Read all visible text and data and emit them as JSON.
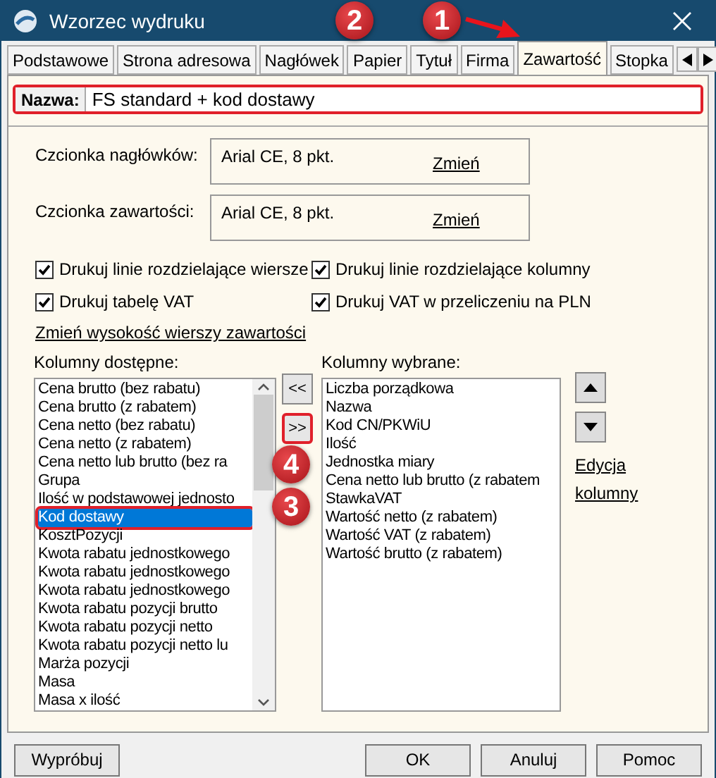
{
  "window": {
    "title": "Wzorzec wydruku"
  },
  "tabs": [
    {
      "label": "Podstawowe",
      "selected": false
    },
    {
      "label": "Strona adresowa",
      "selected": false
    },
    {
      "label": "Nagłówek",
      "selected": false
    },
    {
      "label": "Papier",
      "selected": false
    },
    {
      "label": "Tytuł",
      "selected": false
    },
    {
      "label": "Firma",
      "selected": false
    },
    {
      "label": "Zawartość",
      "selected": true
    },
    {
      "label": "Stopka",
      "selected": false
    }
  ],
  "name_field": {
    "label": "Nazwa:",
    "value": "FS standard + kod dostawy",
    "highlighted": true
  },
  "fonts": [
    {
      "label": "Czcionka nagłówków:",
      "value": "Arial CE, 8 pkt.",
      "link": "Zmień"
    },
    {
      "label": "Czcionka zawartości:",
      "value": "Arial CE, 8 pkt.",
      "link": "Zmień"
    }
  ],
  "options": [
    {
      "label": "Drukuj linie rozdzielające wiersze",
      "checked": true
    },
    {
      "label": "Drukuj linie rozdzielające kolumny",
      "checked": true
    },
    {
      "label": "Drukuj tabelę VAT",
      "checked": true
    },
    {
      "label": "Drukuj VAT w przeliczeniu na PLN",
      "checked": true
    }
  ],
  "row_height_link": "Zmień wysokość wierszy zawartości",
  "available": {
    "label": "Kolumny dostępne:",
    "items": [
      {
        "text": "Cena brutto (bez rabatu)",
        "selected": false
      },
      {
        "text": "Cena brutto (z rabatem)",
        "selected": false
      },
      {
        "text": "Cena netto (bez rabatu)",
        "selected": false
      },
      {
        "text": "Cena netto (z rabatem)",
        "selected": false
      },
      {
        "text": "Cena netto lub brutto (bez ra",
        "selected": false
      },
      {
        "text": "Grupa",
        "selected": false
      },
      {
        "text": "Ilość w podstawowej jednosto",
        "selected": false
      },
      {
        "text": "Kod dostawy",
        "selected": true
      },
      {
        "text": "KosztPozycji",
        "selected": false
      },
      {
        "text": "Kwota rabatu jednostkowego",
        "selected": false
      },
      {
        "text": "Kwota rabatu jednostkowego",
        "selected": false
      },
      {
        "text": "Kwota rabatu jednostkowego",
        "selected": false
      },
      {
        "text": "Kwota rabatu pozycji brutto",
        "selected": false
      },
      {
        "text": "Kwota rabatu pozycji netto",
        "selected": false
      },
      {
        "text": "Kwota rabatu pozycji netto lu",
        "selected": false
      },
      {
        "text": "Marża pozycji",
        "selected": false
      },
      {
        "text": "Masa",
        "selected": false
      },
      {
        "text": "Masa x ilość",
        "selected": false
      }
    ]
  },
  "move_buttons": [
    {
      "label": "<<",
      "highlighted": false
    },
    {
      "label": ">>",
      "highlighted": true
    }
  ],
  "chosen": {
    "label": "Kolumny wybrane:",
    "items": [
      "Liczba porządkowa",
      "Nazwa",
      "Kod CN/PKWiU",
      "Ilość",
      "Jednostka miary",
      "Cena netto lub brutto (z rabatem",
      "StawkaVAT",
      "Wartość netto (z rabatem)",
      "Wartość VAT (z rabatem)",
      "Wartość brutto (z rabatem)"
    ]
  },
  "edit_column_link": "Edycja kolumny",
  "footer_buttons": [
    {
      "label": "Wypróbuj",
      "kind": "left"
    },
    {
      "label": "OK",
      "kind": "right"
    },
    {
      "label": "Anuluj",
      "kind": "right"
    },
    {
      "label": "Pomoc",
      "kind": "right"
    }
  ],
  "annotations": [
    {
      "label": "1"
    },
    {
      "label": "2"
    },
    {
      "label": "3"
    },
    {
      "label": "4"
    }
  ]
}
